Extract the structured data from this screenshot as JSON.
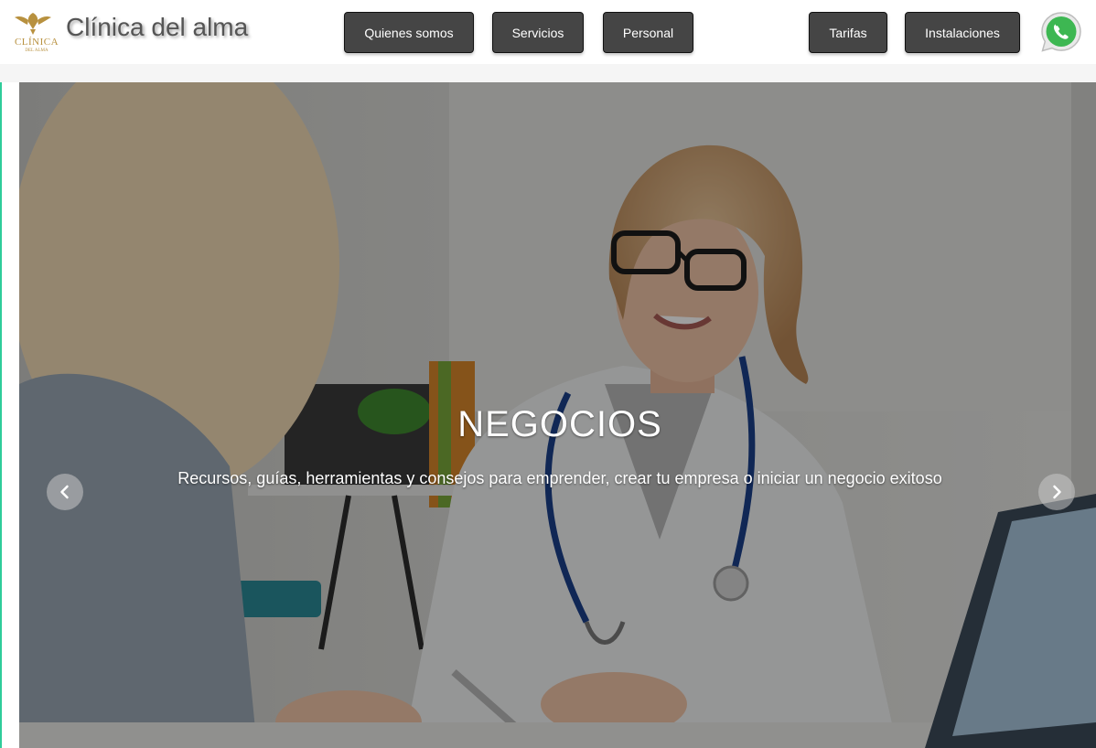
{
  "brand": {
    "logo_text": "CLÍNICA",
    "logo_subtext": "DEL ALMA",
    "site_title": "Clínica del alma"
  },
  "nav": {
    "items": [
      {
        "label": "Quienes somos"
      },
      {
        "label": "Servicios"
      },
      {
        "label": "Personal"
      },
      {
        "label": "Tarifas"
      },
      {
        "label": "Instalaciones"
      }
    ],
    "whatsapp_icon": "whatsapp-icon"
  },
  "hero": {
    "title": "NEGOCIOS",
    "subtitle": "Recursos, guías, herramientas y consejos para emprender, crear tu empresa o iniciar un negocio exitoso",
    "prev_icon": "chevron-left-icon",
    "next_icon": "chevron-right-icon"
  },
  "colors": {
    "nav_button_bg": "#454545",
    "logo_gold": "#b8913f",
    "whatsapp_green": "#3db752",
    "accent_left_border": "#2ecc9a"
  }
}
